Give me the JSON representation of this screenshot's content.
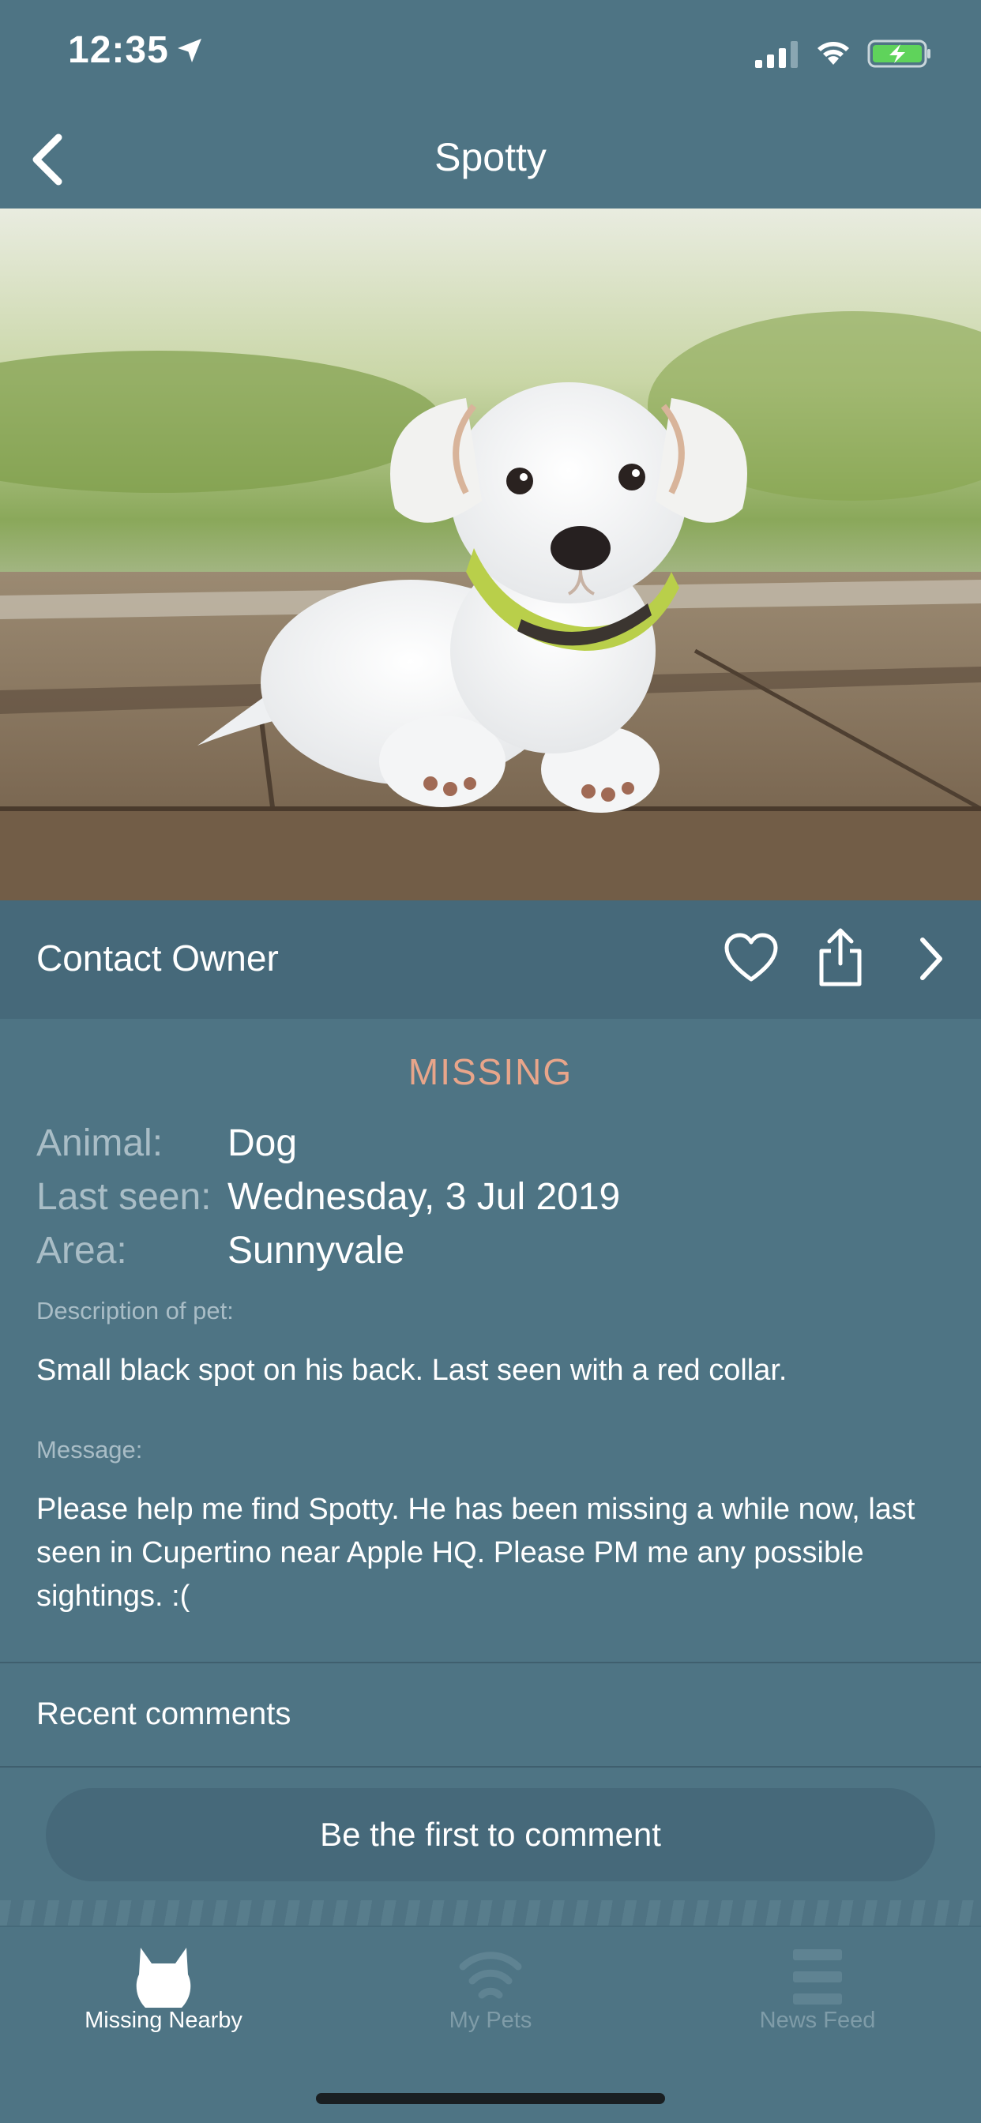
{
  "status_bar": {
    "time": "12:35"
  },
  "nav": {
    "title": "Spotty"
  },
  "actions": {
    "contact_label": "Contact Owner"
  },
  "details": {
    "status": "MISSING",
    "rows": [
      {
        "key": "Animal:",
        "value": "Dog"
      },
      {
        "key": "Last seen:",
        "value": "Wednesday, 3 Jul 2019"
      },
      {
        "key": "Area:",
        "value": "Sunnyvale"
      }
    ],
    "description_label": "Description of  pet:",
    "description": "Small black spot on his back. Last seen with a red collar.",
    "message_label": "Message:",
    "message": "Please help me find Spotty. He has been missing a while now, last seen in Cupertino near Apple HQ. Please PM me any possible sightings. :("
  },
  "comments": {
    "header": "Recent comments",
    "first_comment_button": "Be the first to comment"
  },
  "tabs": [
    {
      "label": "Missing Nearby",
      "icon": "cat-icon",
      "active": true
    },
    {
      "label": "My Pets",
      "icon": "signal-waves-icon",
      "active": false
    },
    {
      "label": "News Feed",
      "icon": "menu-lines-icon",
      "active": false
    }
  ],
  "colors": {
    "background": "#4e7484",
    "action_row": "#46697a",
    "missing_accent": "#e8a58a",
    "muted_label": "#a9bdc6"
  }
}
